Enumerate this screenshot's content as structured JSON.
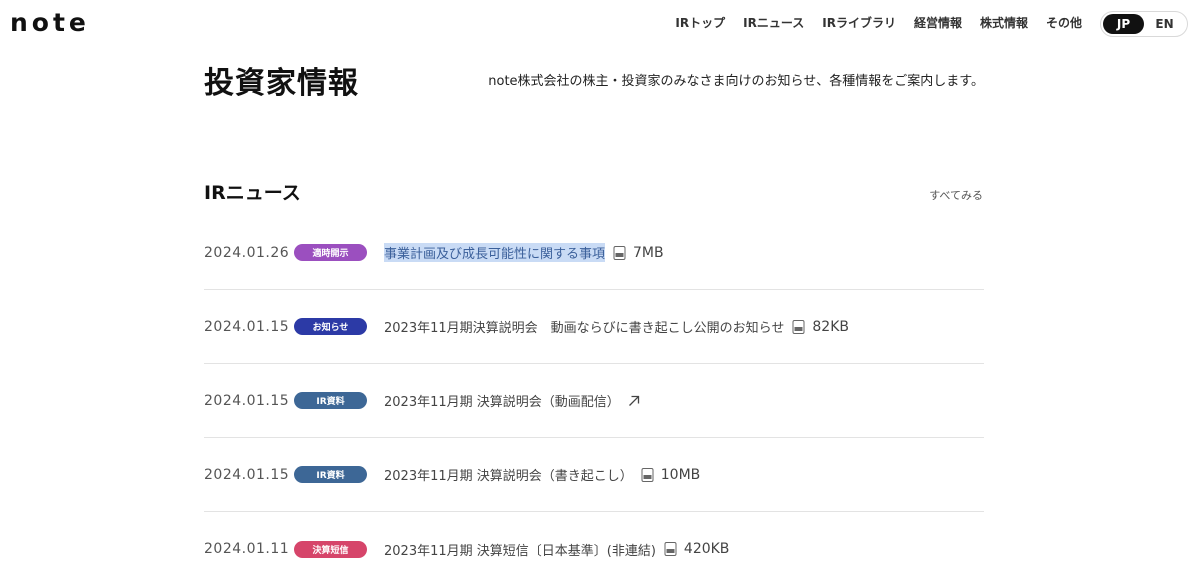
{
  "header": {
    "logo": "note",
    "nav": [
      {
        "label": "IRトップ"
      },
      {
        "label": "IRニュース"
      },
      {
        "label": "IRライブラリ"
      },
      {
        "label": "経営情報"
      },
      {
        "label": "株式情報"
      },
      {
        "label": "その他"
      }
    ],
    "lang": {
      "jp": "JP",
      "en": "EN",
      "active": "JP"
    }
  },
  "hero": {
    "title": "投資家情報",
    "description": "note株式会社の株主・投資家のみなさま向けのお知らせ、各種情報をご案内します。"
  },
  "ir_news": {
    "title": "IRニュース",
    "see_all": "すべてみる",
    "items": [
      {
        "date": "2024.01.26",
        "badge": "適時開示",
        "badge_color": "#9b4fbf",
        "title": "事業計画及び成長可能性に関する事項",
        "icon": "pdf-icon",
        "size": "7MB"
      },
      {
        "date": "2024.01.15",
        "badge": "お知らせ",
        "badge_color": "#2c3aa6",
        "title": "2023年11月期決算説明会　動画ならびに書き起こし公開のお知らせ",
        "icon": "pdf-icon",
        "size": "82KB"
      },
      {
        "date": "2024.01.15",
        "badge": "IR資料",
        "badge_color": "#3d6796",
        "title": "2023年11月期 決算説明会（動画配信）",
        "icon": "external-link-icon",
        "size": ""
      },
      {
        "date": "2024.01.15",
        "badge": "IR資料",
        "badge_color": "#3d6796",
        "title": "2023年11月期 決算説明会（書き起こし）",
        "icon": "pdf-icon",
        "size": "10MB"
      },
      {
        "date": "2024.01.11",
        "badge": "決算短信",
        "badge_color": "#d6456a",
        "title": "2023年11月期 決算短信〔日本基準〕(非連結)",
        "icon": "pdf-icon",
        "size": "420KB"
      }
    ]
  }
}
